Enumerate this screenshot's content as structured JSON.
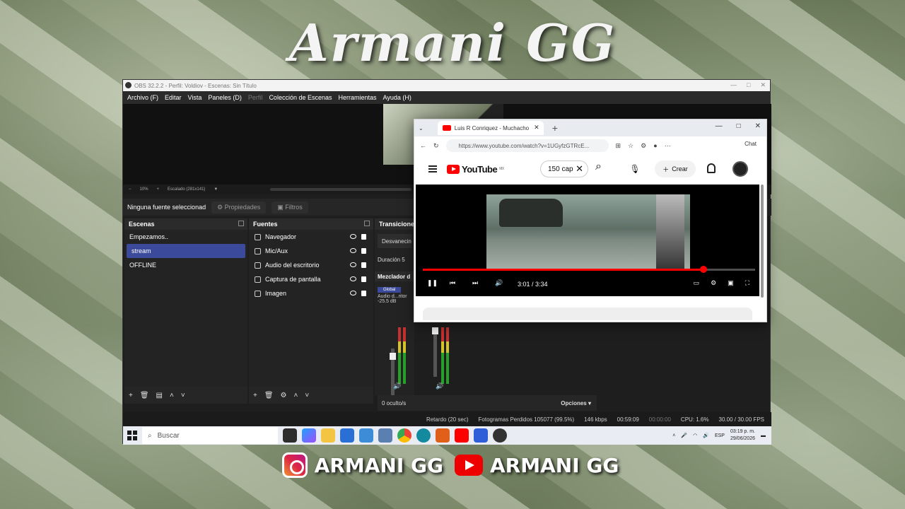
{
  "overlay": {
    "title": "Armani GG",
    "instagram": "ARMANI GG",
    "youtube": "ARMANI GG"
  },
  "obs": {
    "window_title": "OBS 32.2.2 - Perfil: Voldiov - Escenas: Sin Título",
    "menu": [
      "Archivo (F)",
      "Editar",
      "Vista",
      "Paneles (D)",
      "Perfil",
      "Colección de Escenas",
      "Herramientas",
      "Ayuda (H)"
    ],
    "zoom": "10%",
    "zoom_plus": "+",
    "zoom_minus": "−",
    "zoom_mode": "Escalado (281x141)",
    "no_source": "Ninguna fuente seleccionad",
    "properties_btn": "Propiedades",
    "filters_btn": "Filtros",
    "scenes_title": "Escenas",
    "scenes": [
      "Empezamos..",
      "stream",
      "OFFLINE"
    ],
    "selected_scene": 1,
    "sources_title": "Fuentes",
    "sources": [
      "Navegador",
      "Mic/Aux",
      "Audio del escritorio",
      "Captura de pantalla",
      "Imagen"
    ],
    "transitions_title": "Transicione",
    "transition_value": "Desvanecin",
    "duration_label": "Duración",
    "duration_value": "5",
    "mixer_title": "Mezclador d",
    "global_label": "Global",
    "mixer_channel": "Audio d...ritor",
    "mixer_db": "-25.5 dB",
    "hidden_count": "0 oculto/s",
    "options": "Opciones",
    "status": {
      "delay": "Retardo (20 sec)",
      "dropped": "Fotogramas Perdidos 105077 (99.5%)",
      "kbps": "146 kbps",
      "stream_time": "00:59:09",
      "rec_time": "00:00:00",
      "cpu": "CPU: 1.6%",
      "fps": "30.00 / 30.00 FPS"
    }
  },
  "taskbar": {
    "search_placeholder": "Buscar",
    "lang": "ESP",
    "time": "03:19 p. m.",
    "date": "29/06/2026"
  },
  "browser": {
    "tab_title": "Luis R Conriquez - Muchacho",
    "url": "https://www.youtube.com/watch?v=1UGyfzGTRcE...",
    "chat_label": "Chat",
    "yt_logo": "YouTube",
    "yt_region": "MX",
    "search_value": "150 cap",
    "create_label": "Crear",
    "time_display": "3:01 / 3:34",
    "progress": 0.845
  },
  "colors": {
    "accent": "#3b4a9a",
    "youtube_red": "#ff0000"
  }
}
